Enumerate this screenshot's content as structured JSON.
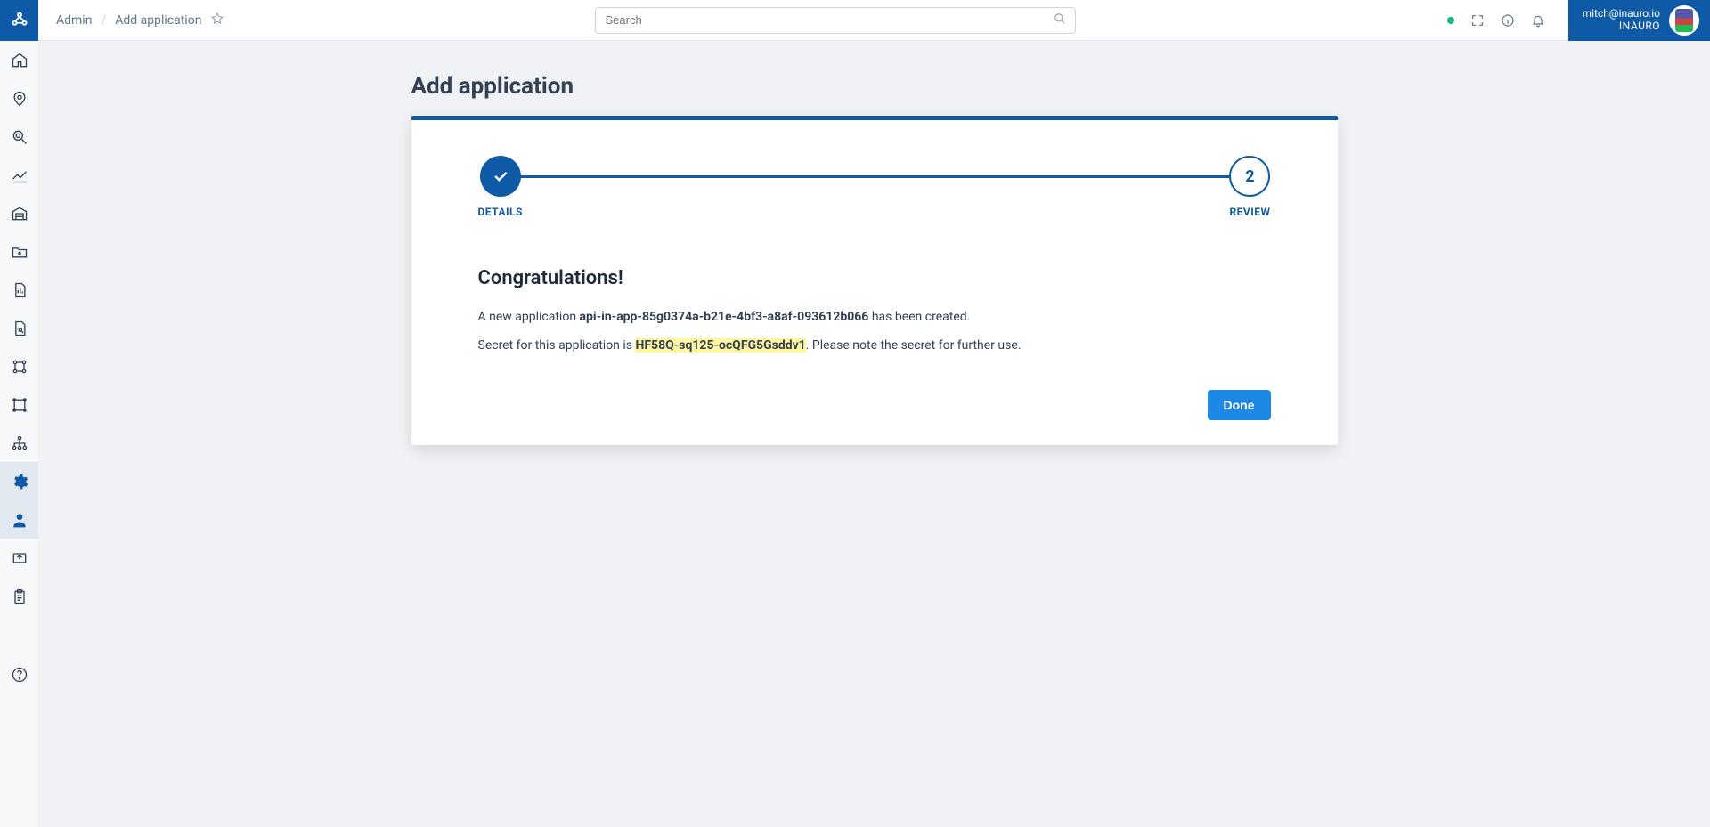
{
  "breadcrumb": {
    "root": "Admin",
    "current": "Add application"
  },
  "search": {
    "placeholder": "Search"
  },
  "user": {
    "email": "mitch@inauro.io",
    "org": "INAURO"
  },
  "page": {
    "title": "Add application"
  },
  "stepper": {
    "step1": {
      "label": "DETAILS"
    },
    "step2": {
      "number": "2",
      "label": "REVIEW"
    }
  },
  "result": {
    "heading": "Congratulations!",
    "line1_pre": "A new application ",
    "app_id": "api-in-app-85g0374a-b21e-4bf3-a8af-093612b066",
    "line1_post": " has been created.",
    "line2_pre": "Secret for this application is ",
    "secret": "HF58Q-sq125-ocQFG5Gsddv1",
    "line2_post": ". Please note the secret for further use."
  },
  "buttons": {
    "done": "Done"
  }
}
